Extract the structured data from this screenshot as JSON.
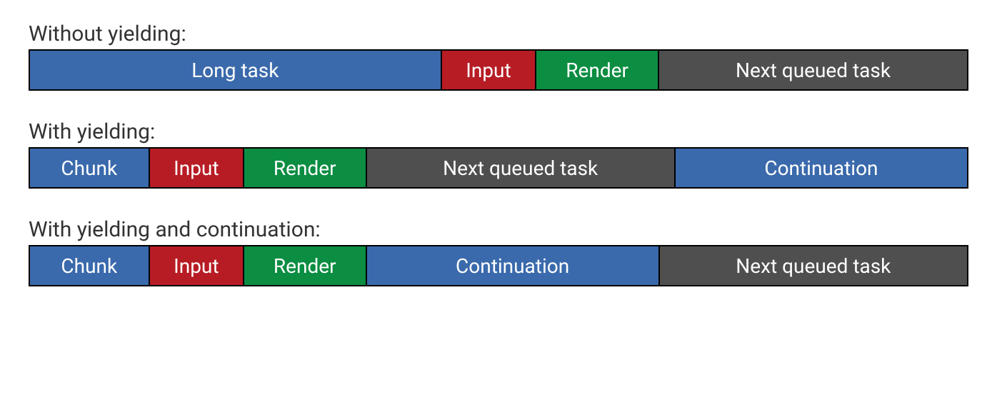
{
  "sections": [
    {
      "title": "Without yielding:",
      "blocks": [
        {
          "label": "Long task",
          "color": "blue",
          "flex": 44
        },
        {
          "label": "Input",
          "color": "red",
          "flex": 10
        },
        {
          "label": "Render",
          "color": "green",
          "flex": 13
        },
        {
          "label": "Next queued task",
          "color": "gray",
          "flex": 33
        }
      ]
    },
    {
      "title": "With yielding:",
      "blocks": [
        {
          "label": "Chunk",
          "color": "blue",
          "flex": 12.7
        },
        {
          "label": "Input",
          "color": "red",
          "flex": 10
        },
        {
          "label": "Render",
          "color": "green",
          "flex": 13
        },
        {
          "label": "Next queued task",
          "color": "gray",
          "flex": 33
        },
        {
          "label": "Continuation",
          "color": "blue",
          "flex": 31.3
        }
      ]
    },
    {
      "title": "With yielding and continuation:",
      "blocks": [
        {
          "label": "Chunk",
          "color": "blue",
          "flex": 12.7
        },
        {
          "label": "Input",
          "color": "red",
          "flex": 10
        },
        {
          "label": "Render",
          "color": "green",
          "flex": 13
        },
        {
          "label": "Continuation",
          "color": "blue",
          "flex": 31.3
        },
        {
          "label": "Next queued task",
          "color": "gray",
          "flex": 33
        }
      ]
    }
  ]
}
